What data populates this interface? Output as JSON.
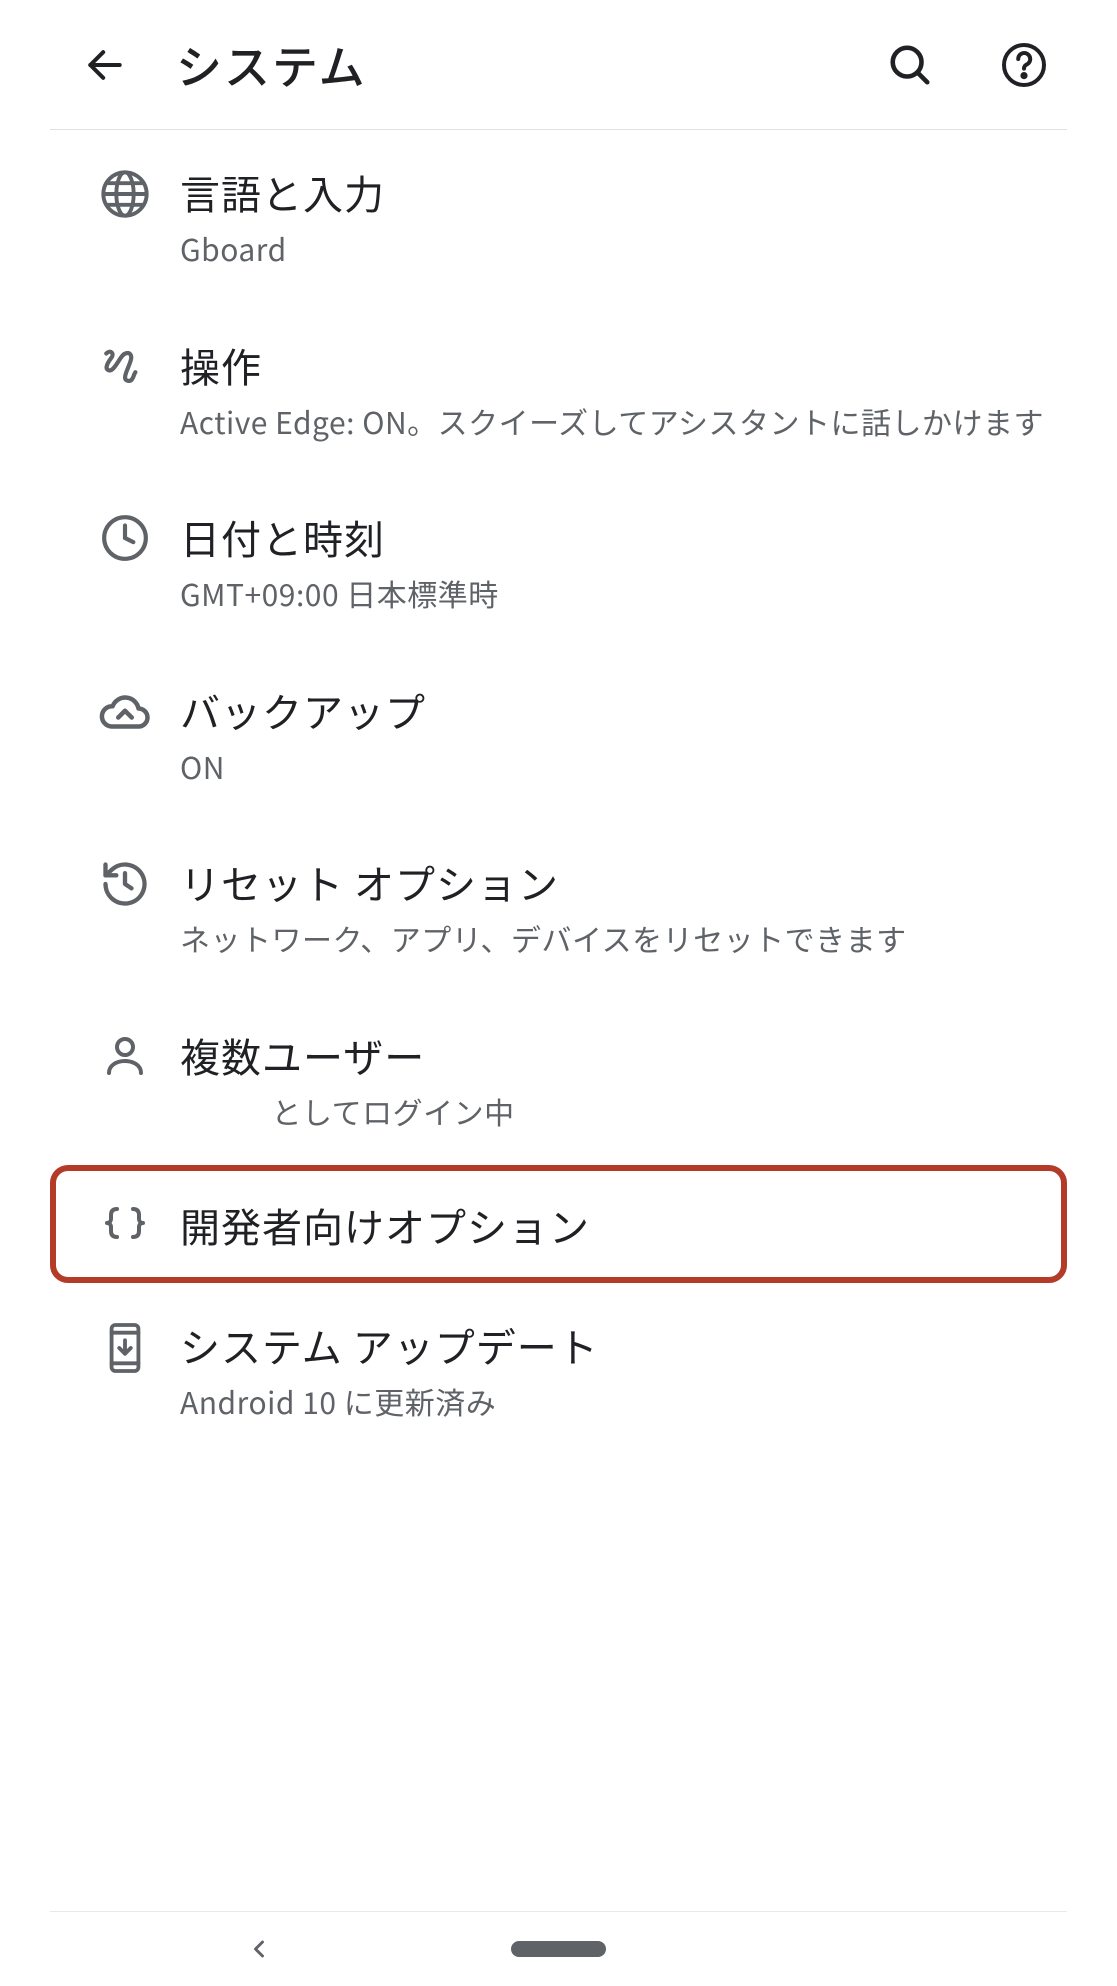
{
  "header": {
    "title": "システム"
  },
  "items": [
    {
      "icon": "globe-icon",
      "title": "言語と入力",
      "subtitle": "Gboard"
    },
    {
      "icon": "gesture-icon",
      "title": "操作",
      "subtitle": "Active Edge: ON。スクイーズしてアシスタントに話しかけます"
    },
    {
      "icon": "clock-icon",
      "title": "日付と時刻",
      "subtitle": "GMT+09:00 日本標準時"
    },
    {
      "icon": "cloud-upload-icon",
      "title": "バックアップ",
      "subtitle": "ON"
    },
    {
      "icon": "history-icon",
      "title": "リセット オプション",
      "subtitle": "ネットワーク、アプリ、デバイスをリセットできます"
    },
    {
      "icon": "person-icon",
      "title": "複数ユーザー",
      "subtitle": "　　　としてログイン中"
    },
    {
      "icon": "braces-icon",
      "title": "開発者向けオプション",
      "subtitle": null,
      "highlight": true
    },
    {
      "icon": "system-update-icon",
      "title": "システム アップデート",
      "subtitle": "Android 10 に更新済み"
    }
  ]
}
